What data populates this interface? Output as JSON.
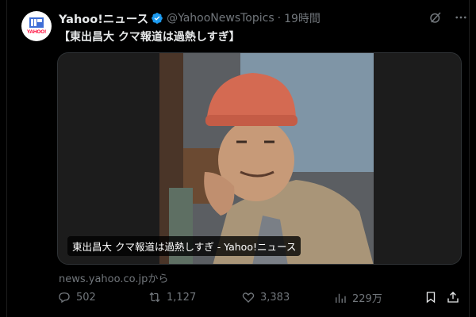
{
  "tweet": {
    "display_name": "Yahoo!ニュース",
    "handle": "@YahooNewsTopics",
    "separator": "·",
    "time": "19時間",
    "avatar_text": "YAHOO!",
    "text": "【東出昌大 クマ報道は過熱しすぎ】"
  },
  "card": {
    "caption": "東出昌大 クマ報道は過熱しすぎ - Yahoo!ニュース",
    "domain": "news.yahoo.co.jpから"
  },
  "actions": {
    "replies": "502",
    "retweets": "1,127",
    "likes": "3,383",
    "views": "229万"
  },
  "icons": {
    "verified": "verified-badge-icon",
    "grok": "grok-icon",
    "more": "more-icon",
    "reply": "reply-icon",
    "retweet": "retweet-icon",
    "like": "like-icon",
    "views": "views-icon",
    "bookmark": "bookmark-icon",
    "share": "share-icon"
  },
  "colors": {
    "background": "#000000",
    "text": "#e7e9ea",
    "muted": "#71767b",
    "verified": "#1d9bf0",
    "brand": "#ff0033"
  }
}
